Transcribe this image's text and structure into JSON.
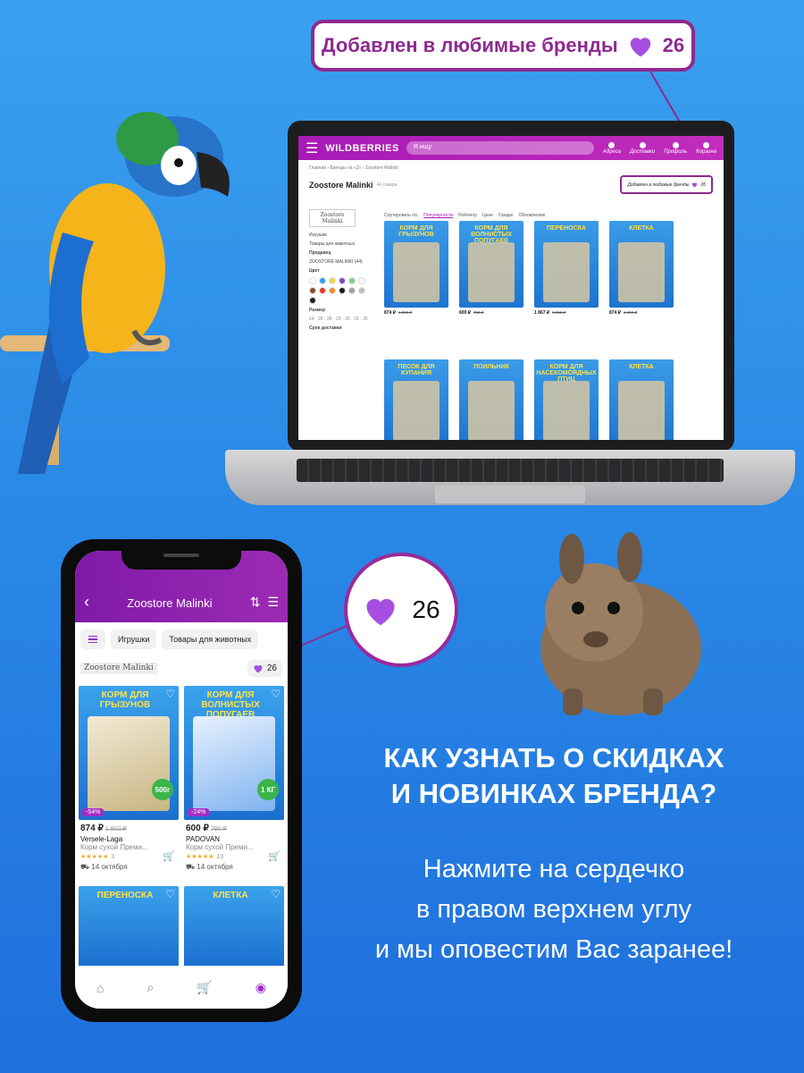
{
  "callout": {
    "text": "Добавлен в любимые бренды",
    "count": "26"
  },
  "laptop": {
    "logo": "WILDBERRIES",
    "search_placeholder": "Я ищу",
    "header_icons": [
      "Адреса",
      "Доставки",
      "Профиль",
      "Корзина"
    ],
    "breadcrumb": "Главная › Бренды на «Z» › Zoostore Malinki",
    "brand": "Zoostore Malinki",
    "brand_count": "44 товара",
    "fav_text": "Добавлен в любимые бренды",
    "fav_count": "26",
    "sidebar": {
      "logo": "Zoostore Malinki",
      "cat1": "Игрушки",
      "cat2": "Товары для животных",
      "seller_label": "Продавец",
      "seller": "ZOOSTORE MALINKI (44)",
      "color_label": "Цвет",
      "colors": [
        "#ffffff",
        "#2aa0ef",
        "#f5d24a",
        "#7a4ab8",
        "#7fd08a",
        "#f7f7f7",
        "#8b4a2b",
        "#e23a2a",
        "#f08a24",
        "#1a1a1a",
        "#9aa0a6",
        "#c0c0c0",
        "#222222"
      ],
      "size_label": "Размер",
      "delivery_label": "Срок доставки"
    },
    "sort": [
      "Сортировать по:",
      "Популярности",
      "Рейтингу",
      "Цене",
      "Скидке",
      "Обновлению"
    ],
    "products": [
      {
        "title": "КОРМ ДЛЯ ГРЫЗУНОВ",
        "price": "874 ₽",
        "old": "1 900 ₽"
      },
      {
        "title": "КОРМ ДЛЯ ВОЛНИСТЫХ ПОПУГАЕВ",
        "price": "600 ₽",
        "old": "798 ₽"
      },
      {
        "title": "ПЕРЕНОСКА",
        "price": "1 867 ₽",
        "old": "3 050 ₽"
      },
      {
        "title": "КЛЕТКА",
        "price": "874 ₽",
        "old": "1 900 ₽"
      },
      {
        "title": "ПЕСОК ДЛЯ КУПАНИЯ",
        "price": "",
        "old": ""
      },
      {
        "title": "ПОИЛЬНИК",
        "price": "",
        "old": ""
      },
      {
        "title": "КОРМ ДЛЯ НАСЕКОМОЯДНЫХ ПТИЦ",
        "price": "",
        "old": ""
      },
      {
        "title": "КЛЕТКА",
        "price": "",
        "old": ""
      }
    ]
  },
  "phone": {
    "title": "Zoostore Malinki",
    "chips": [
      "Игрушки",
      "Товары для животных"
    ],
    "brand_logo": "Zoostore Malinki",
    "fav_count": "26",
    "cards": [
      {
        "title": "КОРМ ДЛЯ ГРЫЗУНОВ",
        "weight": "500г",
        "discount": "-54%",
        "price": "874 ₽",
        "old": "1 900 ₽",
        "name": "Versele-Laga",
        "desc": "Корм сухой Преми...",
        "reviews": "3",
        "date": "14 октября"
      },
      {
        "title": "КОРМ ДЛЯ ВОЛНИСТЫХ ПОПУГАЕВ",
        "weight": "1 КГ",
        "discount": "-24%",
        "price": "600 ₽",
        "old": "790 ₽",
        "name": "PADOVAN",
        "desc": "Корм сухой Преми...",
        "reviews": "13",
        "date": "14 октября"
      },
      {
        "title": "ПЕРЕНОСКА"
      },
      {
        "title": "КЛЕТКА"
      }
    ]
  },
  "bubble": {
    "count": "26"
  },
  "headline": [
    "КАК УЗНАТЬ О СКИДКАХ",
    "И НОВИНКАХ БРЕНДА?"
  ],
  "subtext": [
    "Нажмите на сердечко",
    "в правом верхнем углу",
    "и мы оповестим Вас заранее!"
  ],
  "colors": {
    "accent": "#8e2a8f",
    "heart": "#a64ee0",
    "wb": "#a81ab7"
  }
}
